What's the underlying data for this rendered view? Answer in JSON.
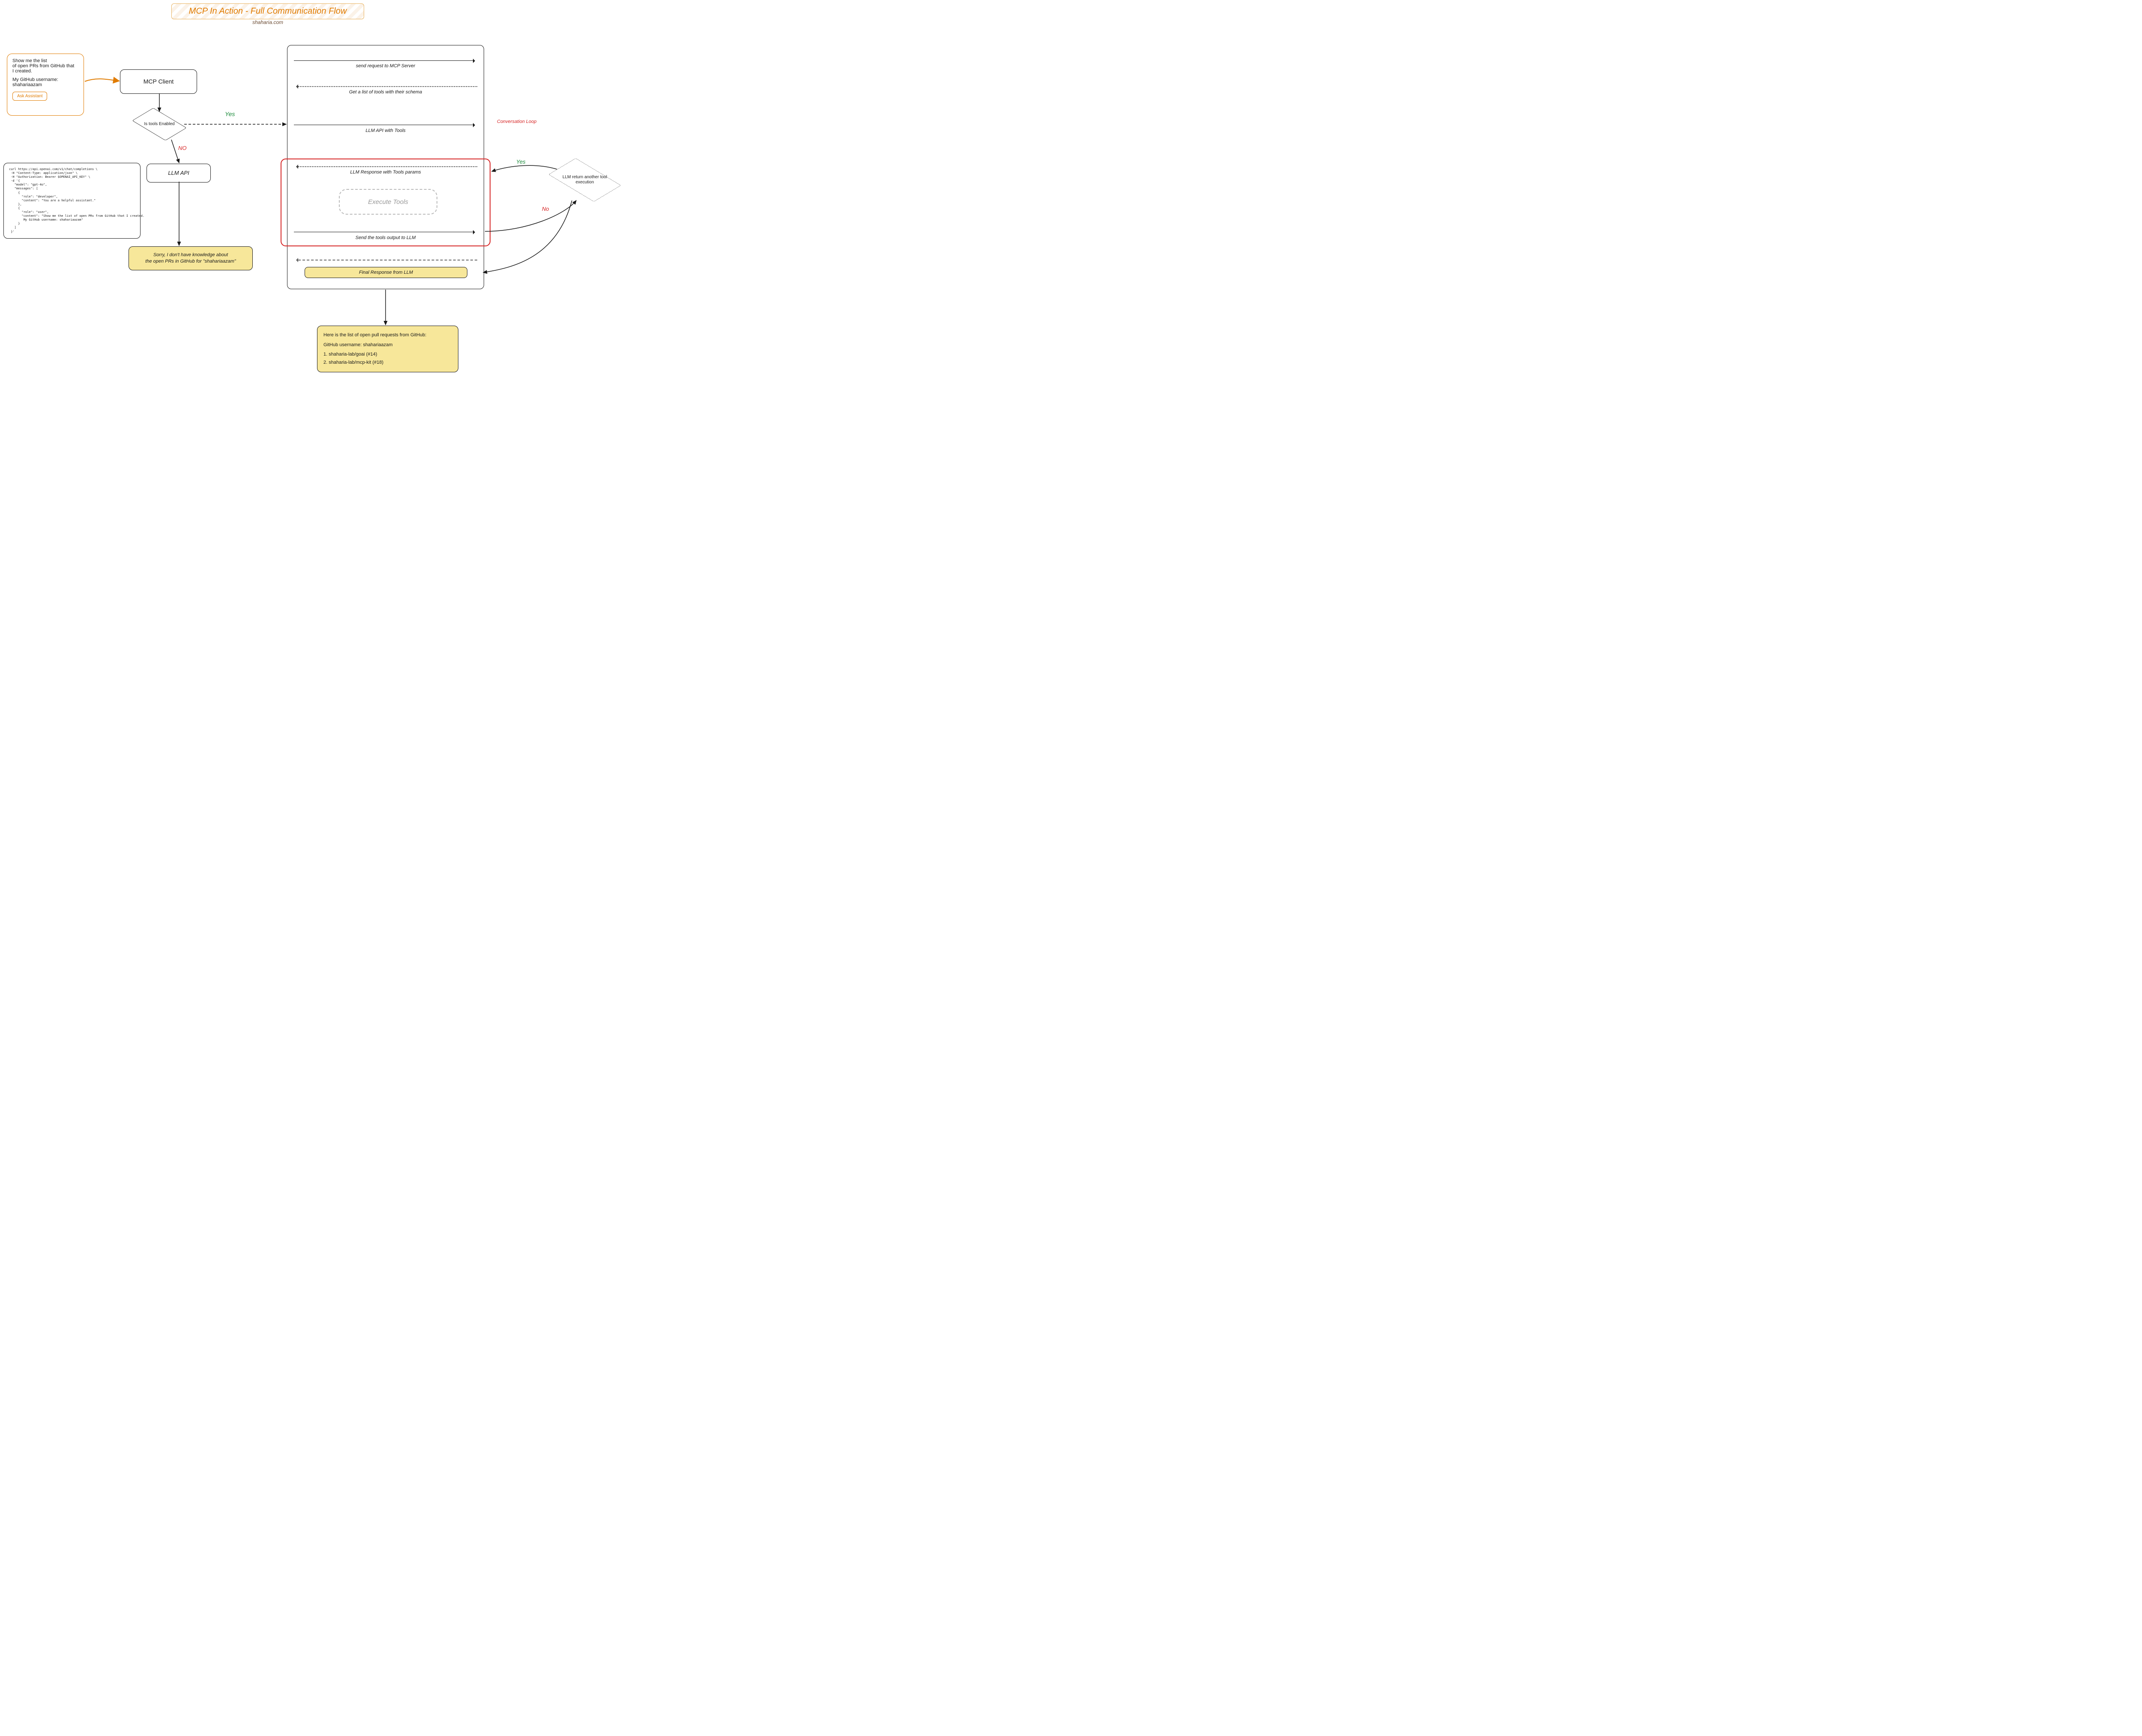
{
  "title": "MCP In Action - Full Communication Flow",
  "subtitle": "shaharia.com",
  "bubble": {
    "line1": "Show me the list",
    "line2": "of open PRs from GitHub that",
    "line3": "I created.",
    "line4": "My GitHub username:",
    "line5": "shahariaazam",
    "button": "Ask Assistant"
  },
  "mcp_client": "MCP Client",
  "decision_tools": "Is tools Enabled",
  "yes_label": "Yes",
  "no_label": "NO",
  "llm_api": "LLM API",
  "sorry": "Sorry, I don't have knowledge about\nthe open PRs in GitHub for \"shahariaazam\"",
  "code": "curl https://api.openai.com/v1/chat/completions \\\n -H \"Content-Type: application/json\" \\\n -H \"Authorization: Bearer $OPENAI_API_KEY\" \\\n -d '{\n   \"model\": \"gpt-4o\",\n   \"messages\": [\n     {\n       \"role\": \"developer\",\n       \"content\": \"You are a helpful assistant.\"\n     },\n     {\n       \"role\": \"user\",\n       \"content\": \"Show me the list of open PRs from GitHub that I created.\n        My GitHub username: shahariaazam\"\n     }\n   ]\n }'",
  "seq": {
    "step1": "send request to MCP Server",
    "step2": "Get a list of tools with their schema",
    "step3": "LLM API with Tools",
    "step4": "LLM Response with Tools params",
    "exec": "Execute Tools",
    "step5": "Send the tools output to LLM",
    "final": "Final Response from LLM"
  },
  "conv_loop_label": "Conversation Loop",
  "decision_loop": "LLM return another tool execution",
  "loop_yes": "Yes",
  "loop_no": "No",
  "result_box": {
    "line1": "Here is the list of open pull requests from GitHub:",
    "line2": "GitHub username: shahariaazam",
    "line3": "1. shaharia-lab/goai (#14)",
    "line4": "2. shaharia-lab/mcp-kit (#18)"
  }
}
